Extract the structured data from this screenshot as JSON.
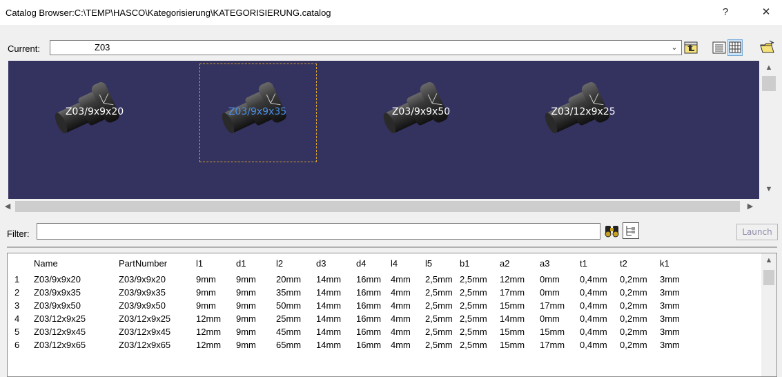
{
  "window": {
    "title": "Catalog Browser:C:\\TEMP\\HASCO\\Kategorisierung\\KATEGORISIERUNG.catalog",
    "help_label": "?",
    "close_label": "✕"
  },
  "current": {
    "label": "Current:",
    "value": "Z03"
  },
  "toolbar": {
    "icons": [
      "up-folder-icon",
      "list-view-icon",
      "detail-view-icon",
      "open-folder-icon"
    ]
  },
  "preview": {
    "items": [
      {
        "label": "Z03/9x9x20",
        "selected": false
      },
      {
        "label": "Z03/9x9x35",
        "selected": true
      },
      {
        "label": "Z03/9x9x50",
        "selected": false
      },
      {
        "label": "Z03/12x9x25",
        "selected": false
      }
    ],
    "background_color": "#34325f",
    "selection_color": "#4a8fe8"
  },
  "filter": {
    "label": "Filter:",
    "value": "",
    "launch_label": "Launch",
    "icons": [
      "binoculars-icon",
      "filter-tree-icon"
    ]
  },
  "table": {
    "columns": [
      "",
      "Name",
      "PartNumber",
      "l1",
      "d1",
      "l2",
      "d3",
      "d4",
      "l4",
      "l5",
      "b1",
      "a2",
      "a3",
      "t1",
      "t2",
      "k1"
    ],
    "rows": [
      [
        "1",
        "Z03/9x9x20",
        "Z03/9x9x20",
        "9mm",
        "9mm",
        "20mm",
        "14mm",
        "16mm",
        "4mm",
        "2,5mm",
        "2,5mm",
        "12mm",
        "0mm",
        "0,4mm",
        "0,2mm",
        "3mm"
      ],
      [
        "2",
        "Z03/9x9x35",
        "Z03/9x9x35",
        "9mm",
        "9mm",
        "35mm",
        "14mm",
        "16mm",
        "4mm",
        "2,5mm",
        "2,5mm",
        "17mm",
        "0mm",
        "0,4mm",
        "0,2mm",
        "3mm"
      ],
      [
        "3",
        "Z03/9x9x50",
        "Z03/9x9x50",
        "9mm",
        "9mm",
        "50mm",
        "14mm",
        "16mm",
        "4mm",
        "2,5mm",
        "2,5mm",
        "15mm",
        "17mm",
        "0,4mm",
        "0,2mm",
        "3mm"
      ],
      [
        "4",
        "Z03/12x9x25",
        "Z03/12x9x25",
        "12mm",
        "9mm",
        "25mm",
        "14mm",
        "16mm",
        "4mm",
        "2,5mm",
        "2,5mm",
        "14mm",
        "0mm",
        "0,4mm",
        "0,2mm",
        "3mm"
      ],
      [
        "5",
        "Z03/12x9x45",
        "Z03/12x9x45",
        "12mm",
        "9mm",
        "45mm",
        "14mm",
        "16mm",
        "4mm",
        "2,5mm",
        "2,5mm",
        "15mm",
        "15mm",
        "0,4mm",
        "0,2mm",
        "3mm"
      ],
      [
        "6",
        "Z03/12x9x65",
        "Z03/12x9x65",
        "12mm",
        "9mm",
        "65mm",
        "14mm",
        "16mm",
        "4mm",
        "2,5mm",
        "2,5mm",
        "15mm",
        "17mm",
        "0,4mm",
        "0,2mm",
        "3mm"
      ]
    ]
  }
}
